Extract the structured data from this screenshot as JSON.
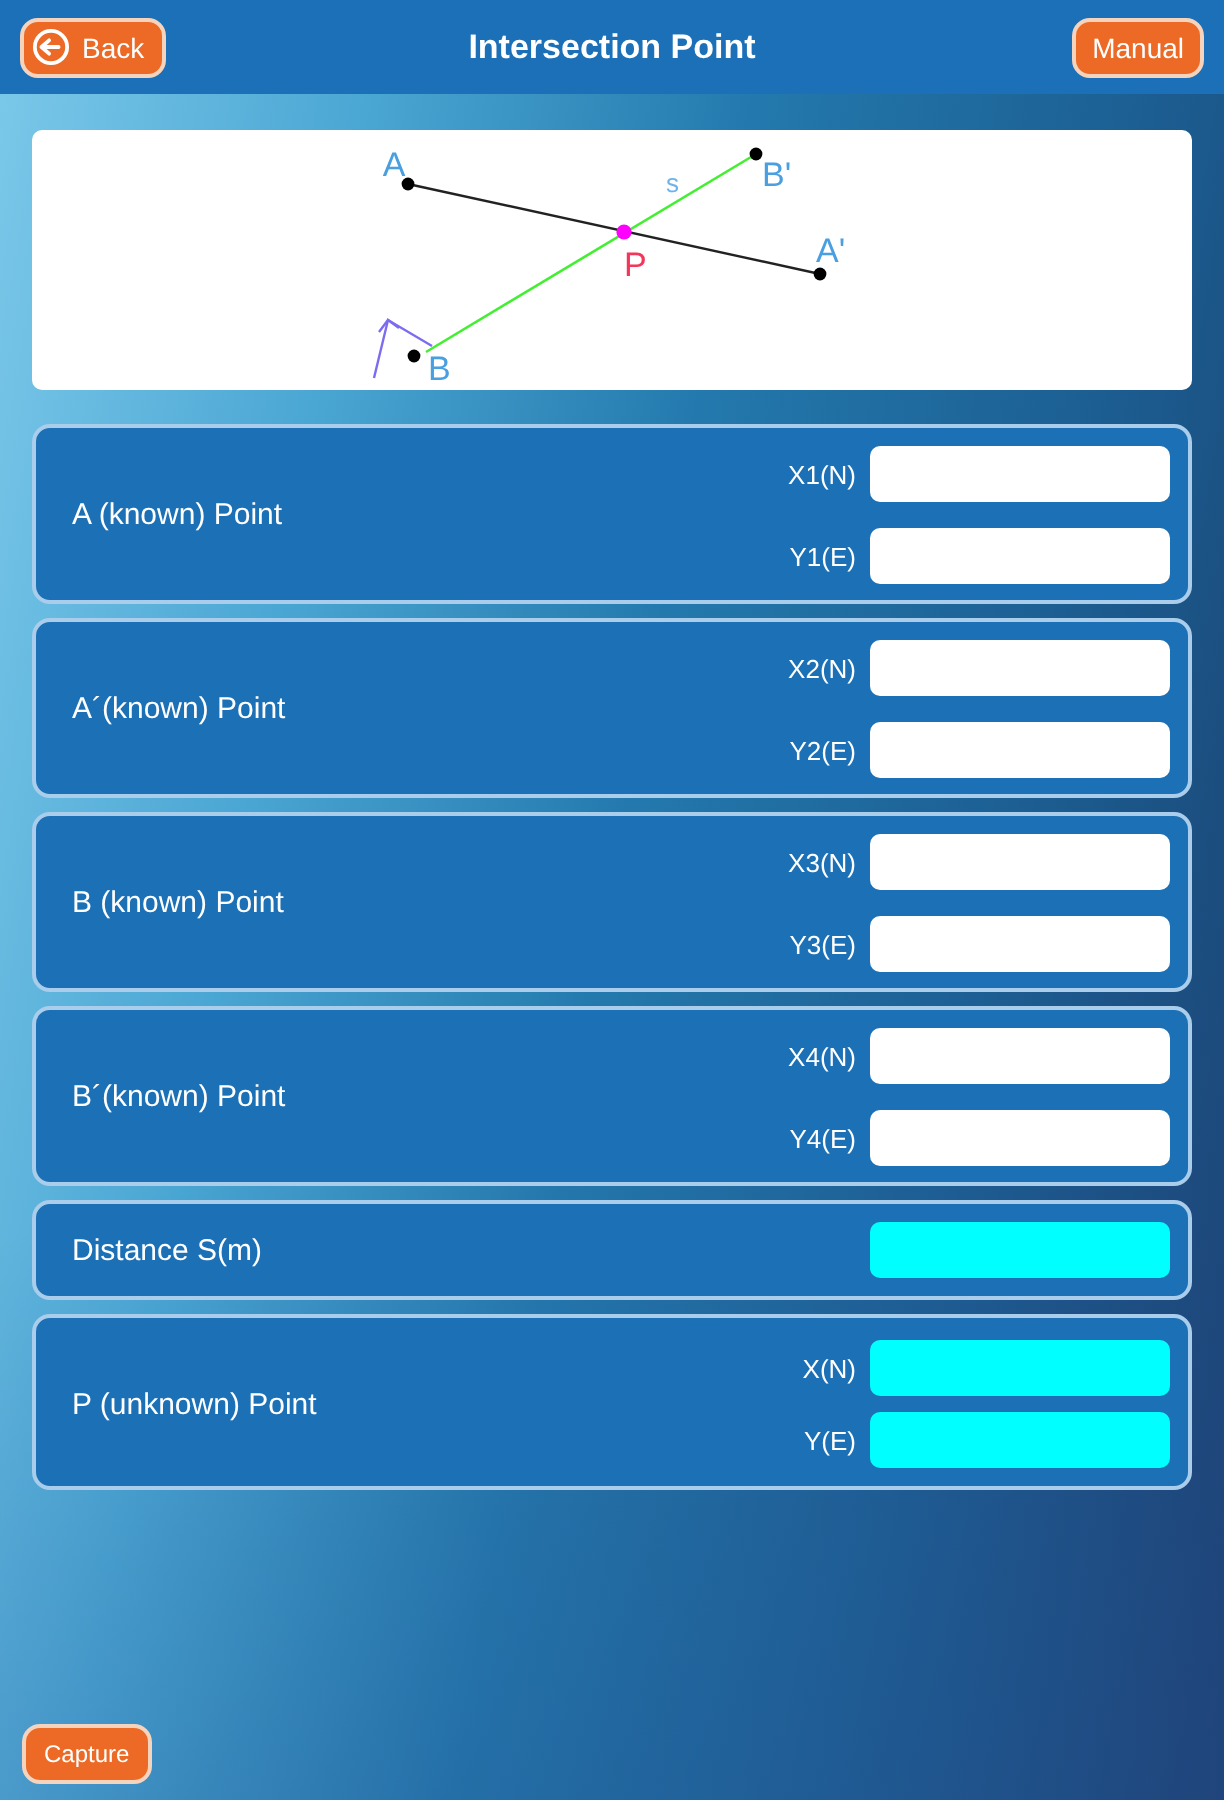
{
  "header": {
    "back_button": "Back",
    "title": "Intersection Point",
    "manual_button": "Manual"
  },
  "diagram": {
    "labels": [
      {
        "text": "A",
        "kind": "point",
        "color": "#4a9fe0"
      },
      {
        "text": "B'",
        "kind": "point",
        "color": "#4a9fe0"
      },
      {
        "text": "A'",
        "kind": "point",
        "color": "#4a9fe0"
      },
      {
        "text": "P",
        "kind": "point",
        "color": "#f4365a"
      },
      {
        "text": "s",
        "kind": "segment",
        "color": "#6fb3ec"
      },
      {
        "text": "B",
        "kind": "point",
        "color": "#4a9fe0"
      }
    ]
  },
  "panels": [
    {
      "kind": "point",
      "title": "A (known) Point",
      "fields": [
        {
          "kind": "input",
          "label": "X1(N)"
        },
        {
          "kind": "input",
          "label": "Y1(E)"
        }
      ]
    },
    {
      "kind": "point",
      "title": "A´(known) Point",
      "fields": [
        {
          "kind": "input",
          "label": "X2(N)"
        },
        {
          "kind": "input",
          "label": "Y2(E)"
        }
      ]
    },
    {
      "kind": "point",
      "title": "B (known) Point",
      "fields": [
        {
          "kind": "input",
          "label": "X3(N)"
        },
        {
          "kind": "input",
          "label": "Y3(E)"
        }
      ]
    },
    {
      "kind": "point",
      "title": "B´(known) Point",
      "fields": [
        {
          "kind": "input",
          "label": "X4(N)"
        },
        {
          "kind": "input",
          "label": "Y4(E)"
        }
      ]
    },
    {
      "kind": "value",
      "title": "Distance S(m)",
      "fields": [
        {
          "kind": "output"
        }
      ]
    },
    {
      "kind": "result",
      "title": "P (unknown) Point",
      "fields": [
        {
          "kind": "output",
          "label": "X(N)"
        },
        {
          "kind": "output",
          "label": "Y(E)"
        }
      ]
    }
  ],
  "capture_button": "Capture"
}
